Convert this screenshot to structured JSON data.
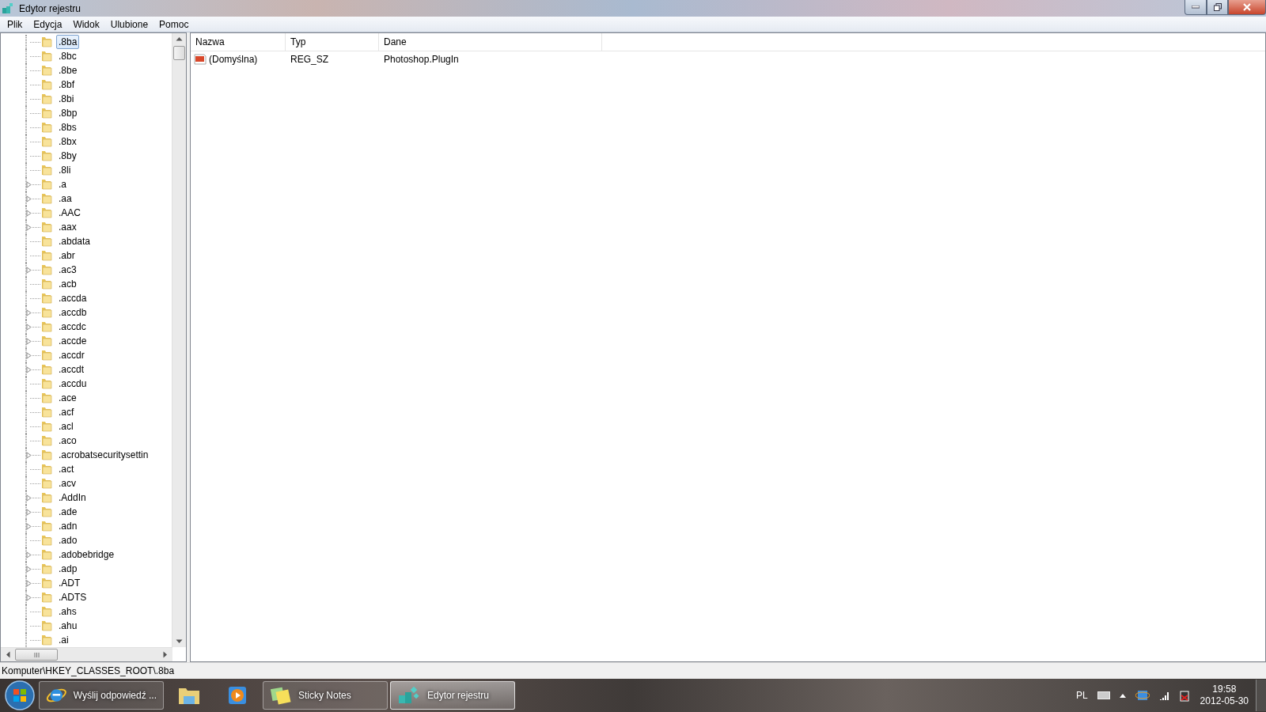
{
  "window": {
    "title": "Edytor rejestru"
  },
  "menu": [
    "Plik",
    "Edycja",
    "Widok",
    "Ulubione",
    "Pomoc"
  ],
  "tree": {
    "items": [
      {
        "name": ".8ba",
        "expandable": false,
        "selected": true
      },
      {
        "name": ".8bc",
        "expandable": false,
        "selected": false
      },
      {
        "name": ".8be",
        "expandable": false,
        "selected": false
      },
      {
        "name": ".8bf",
        "expandable": false,
        "selected": false
      },
      {
        "name": ".8bi",
        "expandable": false,
        "selected": false
      },
      {
        "name": ".8bp",
        "expandable": false,
        "selected": false
      },
      {
        "name": ".8bs",
        "expandable": false,
        "selected": false
      },
      {
        "name": ".8bx",
        "expandable": false,
        "selected": false
      },
      {
        "name": ".8by",
        "expandable": false,
        "selected": false
      },
      {
        "name": ".8li",
        "expandable": false,
        "selected": false
      },
      {
        "name": ".a",
        "expandable": true,
        "selected": false
      },
      {
        "name": ".aa",
        "expandable": true,
        "selected": false
      },
      {
        "name": ".AAC",
        "expandable": true,
        "selected": false
      },
      {
        "name": ".aax",
        "expandable": true,
        "selected": false
      },
      {
        "name": ".abdata",
        "expandable": false,
        "selected": false
      },
      {
        "name": ".abr",
        "expandable": false,
        "selected": false
      },
      {
        "name": ".ac3",
        "expandable": true,
        "selected": false
      },
      {
        "name": ".acb",
        "expandable": false,
        "selected": false
      },
      {
        "name": ".accda",
        "expandable": false,
        "selected": false
      },
      {
        "name": ".accdb",
        "expandable": true,
        "selected": false
      },
      {
        "name": ".accdc",
        "expandable": true,
        "selected": false
      },
      {
        "name": ".accde",
        "expandable": true,
        "selected": false
      },
      {
        "name": ".accdr",
        "expandable": true,
        "selected": false
      },
      {
        "name": ".accdt",
        "expandable": true,
        "selected": false
      },
      {
        "name": ".accdu",
        "expandable": false,
        "selected": false
      },
      {
        "name": ".ace",
        "expandable": false,
        "selected": false
      },
      {
        "name": ".acf",
        "expandable": false,
        "selected": false
      },
      {
        "name": ".acl",
        "expandable": false,
        "selected": false
      },
      {
        "name": ".aco",
        "expandable": false,
        "selected": false
      },
      {
        "name": ".acrobatsecuritysettin",
        "expandable": true,
        "selected": false
      },
      {
        "name": ".act",
        "expandable": false,
        "selected": false
      },
      {
        "name": ".acv",
        "expandable": false,
        "selected": false
      },
      {
        "name": ".AddIn",
        "expandable": true,
        "selected": false
      },
      {
        "name": ".ade",
        "expandable": true,
        "selected": false
      },
      {
        "name": ".adn",
        "expandable": true,
        "selected": false
      },
      {
        "name": ".ado",
        "expandable": false,
        "selected": false
      },
      {
        "name": ".adobebridge",
        "expandable": true,
        "selected": false
      },
      {
        "name": ".adp",
        "expandable": true,
        "selected": false
      },
      {
        "name": ".ADT",
        "expandable": true,
        "selected": false
      },
      {
        "name": ".ADTS",
        "expandable": true,
        "selected": false
      },
      {
        "name": ".ahs",
        "expandable": false,
        "selected": false
      },
      {
        "name": ".ahu",
        "expandable": false,
        "selected": false
      },
      {
        "name": ".ai",
        "expandable": false,
        "selected": false
      }
    ]
  },
  "table": {
    "columns": [
      "Nazwa",
      "Typ",
      "Dane"
    ],
    "rows": [
      {
        "name": "(Domyślna)",
        "type": "REG_SZ",
        "data": "Photoshop.PlugIn"
      }
    ]
  },
  "status_bar": "Komputer\\HKEY_CLASSES_ROOT\\.8ba",
  "taskbar": {
    "buttons": [
      {
        "kind": "ie",
        "label": "Wyślij odpowiedź ...",
        "selected": false
      },
      {
        "kind": "explorer",
        "selected": false
      },
      {
        "kind": "media",
        "selected": false
      },
      {
        "kind": "sticky",
        "label": "Sticky Notes",
        "selected": false
      },
      {
        "kind": "regedit",
        "label": "Edytor rejestru",
        "selected": true
      }
    ],
    "language": "PL",
    "time": "19:58",
    "date": "2012-05-30"
  }
}
